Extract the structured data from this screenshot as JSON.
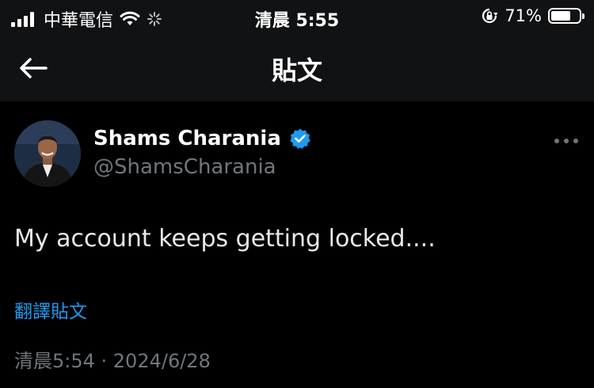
{
  "status_bar": {
    "carrier": "中華電信",
    "time": "清晨 5:55",
    "battery_percent": "71%",
    "battery_level": 0.71
  },
  "nav": {
    "title": "貼文"
  },
  "post": {
    "author_name": "Shams Charania",
    "handle": "@ShamsCharania",
    "verified": true,
    "text": "My account keeps getting locked....",
    "translate_label": "翻譯貼文",
    "timestamp": "清晨5:54 · 2024/6/28"
  },
  "colors": {
    "background": "#000000",
    "header_background": "#101214",
    "accent": "#1d9bf0",
    "muted": "#71767b"
  }
}
